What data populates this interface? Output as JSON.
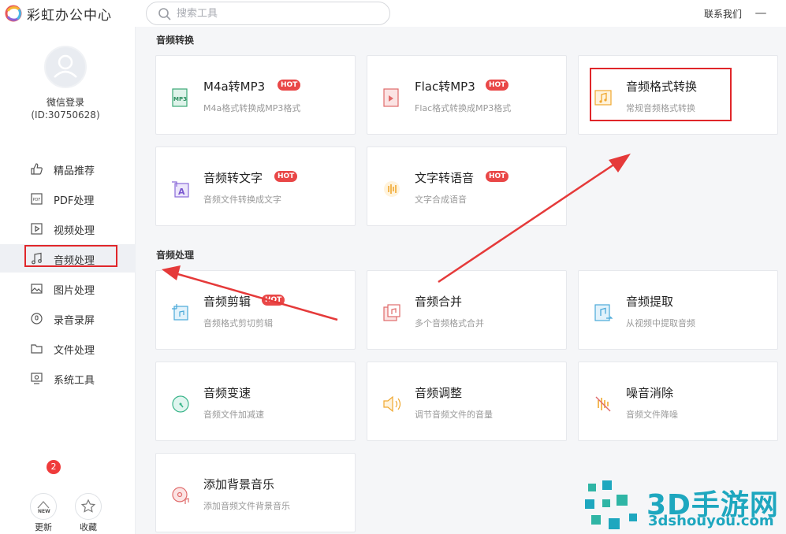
{
  "app": {
    "title": "彩虹办公中心"
  },
  "search": {
    "placeholder": "搜索工具"
  },
  "header": {
    "contact": "联系我们",
    "minimize": "—"
  },
  "user": {
    "name": "微信登录",
    "id": "(ID:30750628)"
  },
  "sidebar": {
    "items": [
      {
        "label": "精品推荐",
        "icon": "thumbs-up-icon"
      },
      {
        "label": "PDF处理",
        "icon": "pdf-icon"
      },
      {
        "label": "视频处理",
        "icon": "video-icon"
      },
      {
        "label": "音频处理",
        "icon": "music-note-icon",
        "active": true
      },
      {
        "label": "图片处理",
        "icon": "image-icon"
      },
      {
        "label": "录音录屏",
        "icon": "record-icon"
      },
      {
        "label": "文件处理",
        "icon": "folder-icon"
      },
      {
        "label": "系统工具",
        "icon": "system-icon"
      }
    ],
    "bottom": {
      "update_label": "更新",
      "update_badge": "2",
      "update_icon_text": "NEW",
      "favorites_label": "收藏"
    }
  },
  "sections": [
    {
      "title": "音频转换",
      "cards": [
        {
          "title": "M4a转MP3",
          "subtitle": "M4a格式转换成MP3格式",
          "hot": true,
          "icon": "mp3-convert-icon"
        },
        {
          "title": "Flac转MP3",
          "subtitle": "Flac格式转换成MP3格式",
          "hot": true,
          "icon": "flac-convert-icon"
        },
        {
          "title": "音频格式转换",
          "subtitle": "常规音频格式转换",
          "hot": false,
          "icon": "audio-format-icon"
        },
        {
          "title": "音频转文字",
          "subtitle": "音频文件转换成文字",
          "hot": true,
          "icon": "audio-to-text-icon"
        },
        {
          "title": "文字转语音",
          "subtitle": "文字合成语音",
          "hot": true,
          "icon": "text-to-speech-icon"
        }
      ]
    },
    {
      "title": "音频处理",
      "cards": [
        {
          "title": "音频剪辑",
          "subtitle": "音频格式剪切剪辑",
          "hot": true,
          "icon": "audio-cut-icon"
        },
        {
          "title": "音频合并",
          "subtitle": "多个音频格式合并",
          "hot": false,
          "icon": "audio-merge-icon"
        },
        {
          "title": "音频提取",
          "subtitle": "从视频中提取音频",
          "hot": false,
          "icon": "audio-extract-icon"
        },
        {
          "title": "音频变速",
          "subtitle": "音频文件加减速",
          "hot": false,
          "icon": "speed-icon"
        },
        {
          "title": "音频调整",
          "subtitle": "调节音频文件的音量",
          "hot": false,
          "icon": "volume-icon"
        },
        {
          "title": "噪音消除",
          "subtitle": "音频文件降噪",
          "hot": false,
          "icon": "noise-reduce-icon"
        },
        {
          "title": "添加背景音乐",
          "subtitle": "添加音频文件背景音乐",
          "hot": false,
          "icon": "bg-music-icon"
        }
      ]
    }
  ],
  "hot_label": "HOT",
  "watermark": {
    "text": "3D手游网",
    "url": "3dshouyou.com"
  },
  "colors": {
    "accent": "#e0262a",
    "hot": "#e94747",
    "watermark": "#1ea7bf"
  }
}
